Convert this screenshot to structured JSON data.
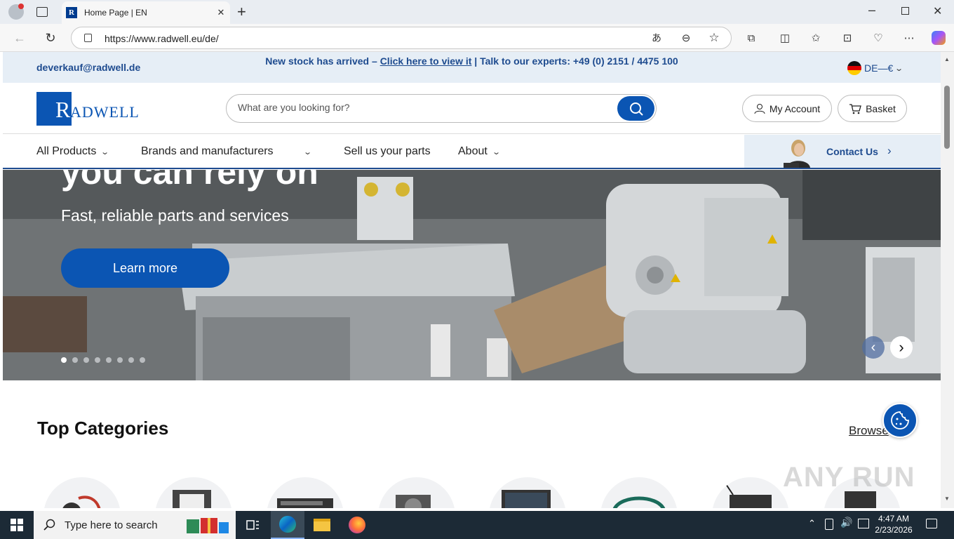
{
  "browser": {
    "tab_title": "Home Page | EN",
    "tab_favicon_letter": "R",
    "url": "https://www.radwell.eu/de/"
  },
  "promo": {
    "email": "deverkauf@radwell.de",
    "message_prefix": "New stock has arrived – ",
    "message_link": "Click here to view it",
    "message_suffix": " | Talk to our experts: +49 (0) 2151 / 4475 100",
    "language": "DE—€"
  },
  "header": {
    "logo_text": "RADWELL",
    "search_placeholder": "What are you looking for?",
    "my_account": "My Account",
    "basket": "Basket"
  },
  "nav": {
    "items": [
      "All Products",
      "Brands and manufacturers",
      "Sell us your parts",
      "About"
    ],
    "contact": "Contact Us"
  },
  "hero": {
    "title": "you can rely on",
    "subtitle": "Fast, reliable parts and services",
    "button": "Learn more",
    "slides_total": 8,
    "active_slide": 1
  },
  "categories": {
    "title": "Top Categories",
    "browse": "Browse"
  },
  "watermark": "ANY RUN",
  "taskbar": {
    "search_placeholder": "Type here to search",
    "time": "4:47 AM",
    "date": "2/23/2026"
  },
  "colors": {
    "brand_blue": "#0b55b3",
    "text_blue": "#1e4b8f",
    "promo_bg": "#e6eef6"
  }
}
